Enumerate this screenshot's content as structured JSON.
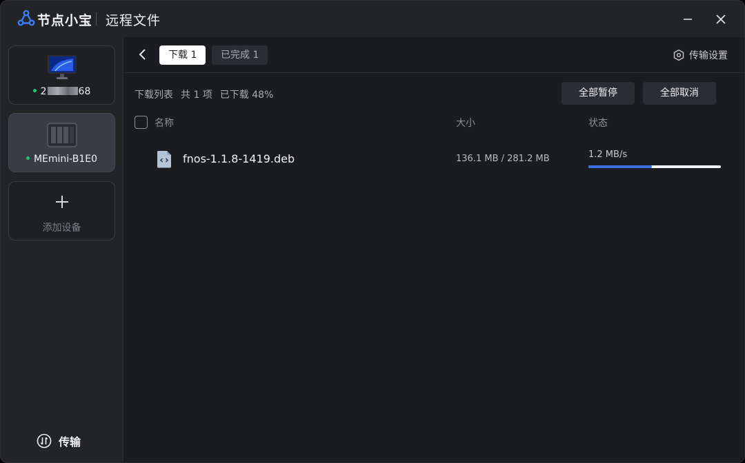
{
  "app": {
    "brand": "节点小宝",
    "window_title": "远程文件"
  },
  "colors": {
    "accent": "#3c6fe6",
    "online": "#23c37a",
    "logo": "#3b7ef5"
  },
  "sidebar": {
    "devices": [
      {
        "label_prefix": "2",
        "label_suffix": "68",
        "status": "online",
        "icon": "desktop-pc-icon",
        "active": false
      },
      {
        "label": "MEmini-B1E0",
        "status": "online",
        "icon": "nas-device-icon",
        "active": true
      }
    ],
    "add_device_label": "添加设备",
    "transfer_label": "传输"
  },
  "topbar": {
    "tabs": [
      {
        "label": "下载 1",
        "active": true
      },
      {
        "label": "已完成 1",
        "active": false
      }
    ],
    "settings_label": "传输设置"
  },
  "list": {
    "summary": {
      "title": "下载列表",
      "count": "共 1 项",
      "downloaded": "已下载 48%"
    },
    "actions": {
      "pause_all": "全部暂停",
      "cancel_all": "全部取消"
    },
    "columns": {
      "name": "名称",
      "size": "大小",
      "status": "状态"
    },
    "items": [
      {
        "name": "fnos-1.1.8-1419.deb",
        "size": "136.1 MB / 281.2 MB",
        "speed": "1.2 MB/s",
        "progress": 0.48,
        "icon": "code-file-icon"
      }
    ]
  }
}
